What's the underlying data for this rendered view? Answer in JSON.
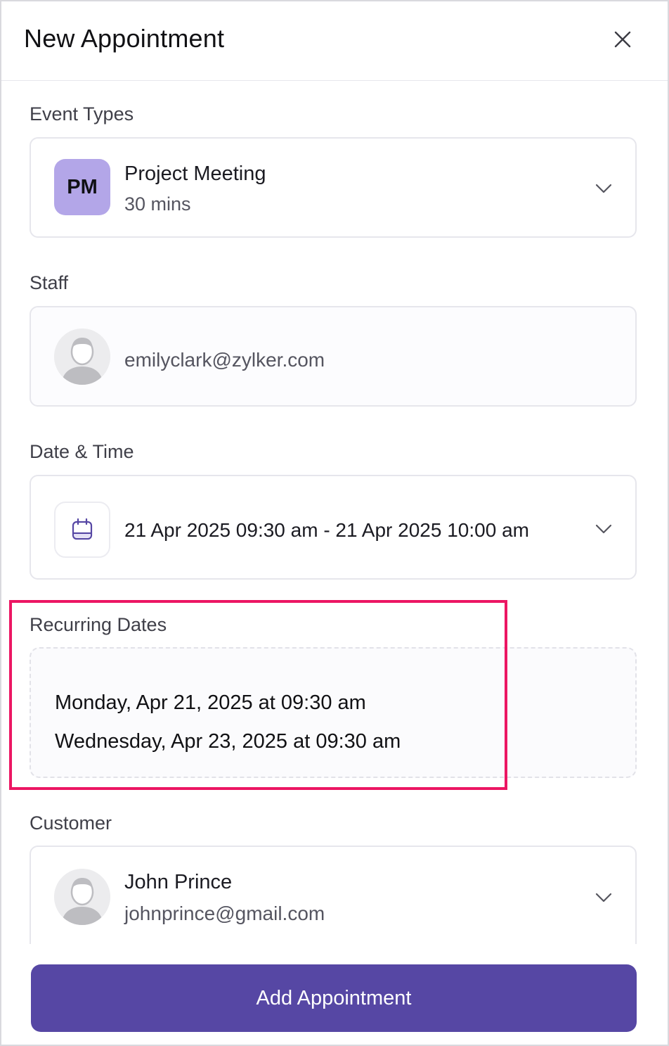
{
  "header": {
    "title": "New Appointment"
  },
  "event_types": {
    "label": "Event Types",
    "badge": "PM",
    "name": "Project Meeting",
    "duration": "30 mins"
  },
  "staff": {
    "label": "Staff",
    "email": "emilyclark@zylker.com"
  },
  "date_time": {
    "label": "Date & Time",
    "value": "21 Apr 2025 09:30 am - 21 Apr 2025 10:00 am"
  },
  "recurring": {
    "label": "Recurring Dates",
    "dates": [
      "Monday, Apr 21, 2025 at 09:30 am",
      "Wednesday, Apr 23, 2025 at 09:30 am"
    ]
  },
  "customer": {
    "label": "Customer",
    "name": "John Prince",
    "email": "johnprince@gmail.com"
  },
  "actions": {
    "add_label": "Add Appointment"
  },
  "colors": {
    "accent": "#5647a4",
    "badge_bg": "#b3a6e8",
    "highlight": "#ec1663"
  },
  "icons": {
    "close": "close-icon",
    "chevron": "chevron-down-icon",
    "calendar": "calendar-icon",
    "avatar": "user-avatar-icon"
  }
}
